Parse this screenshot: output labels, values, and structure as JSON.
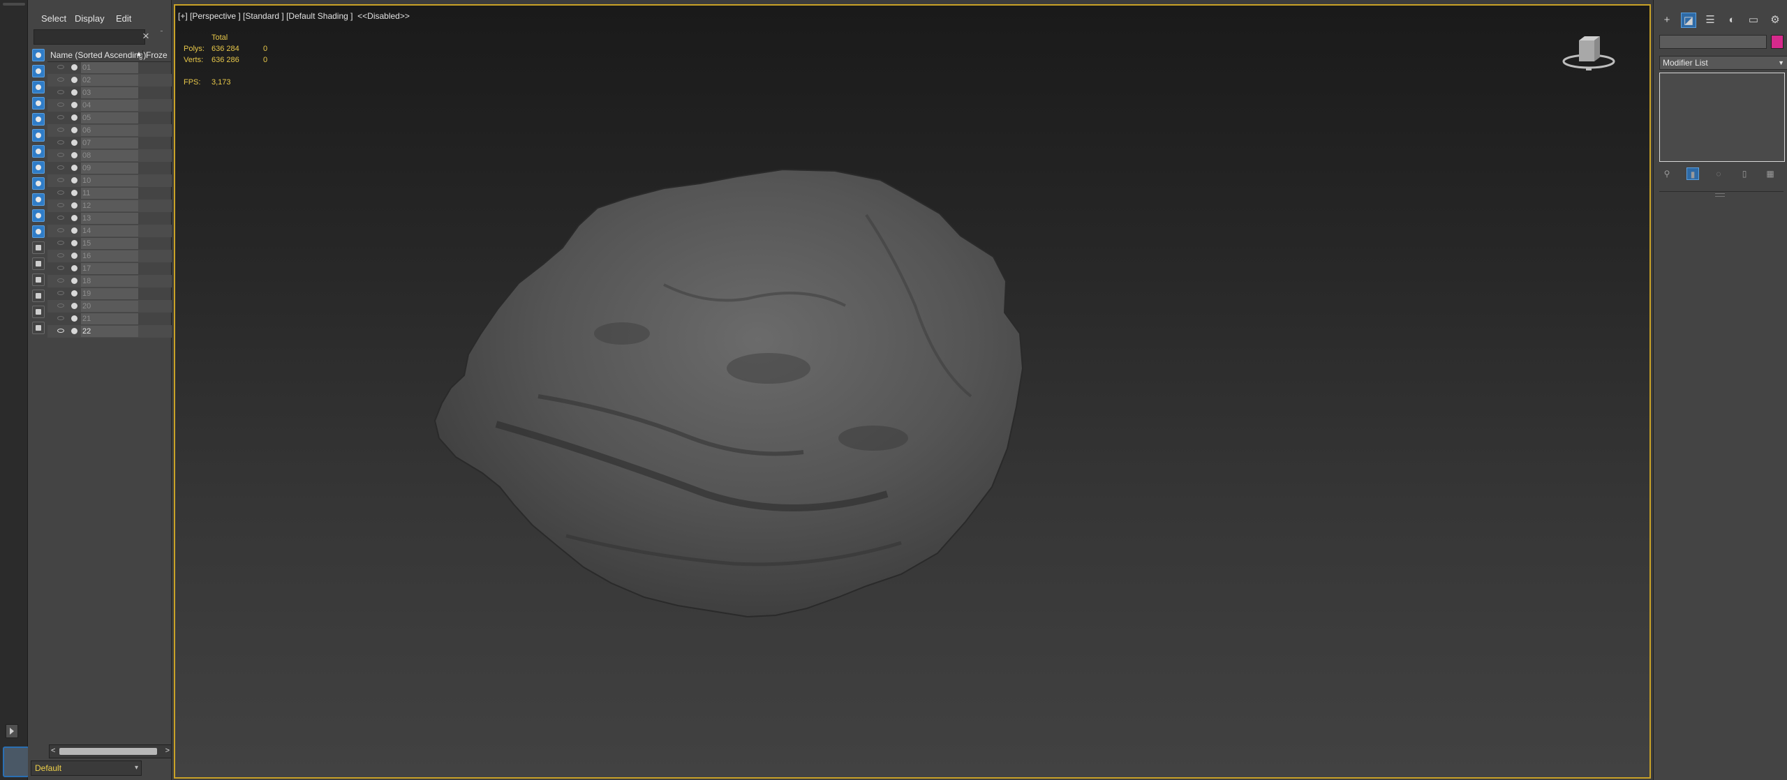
{
  "explorer": {
    "menu": {
      "select": "Select",
      "display": "Display",
      "edit": "Edit"
    },
    "search": {
      "value": "",
      "placeholder": ""
    },
    "clear_icon": "×",
    "filter_tools": [
      {
        "name": "geometry-filter-icon",
        "on": true
      },
      {
        "name": "shapes-filter-icon",
        "on": true
      },
      {
        "name": "lights-filter-icon",
        "on": true
      },
      {
        "name": "cameras-filter-icon",
        "on": true
      },
      {
        "name": "helpers-filter-icon",
        "on": true
      },
      {
        "name": "space-warps-filter-icon",
        "on": true
      },
      {
        "name": "groups-filter-icon",
        "on": true
      },
      {
        "name": "xrefs-filter-icon",
        "on": true
      },
      {
        "name": "bones-filter-icon",
        "on": true
      },
      {
        "name": "containers-filter-icon",
        "on": true
      },
      {
        "name": "frozen-filter-icon",
        "on": true
      },
      {
        "name": "hidden-filter-icon",
        "on": true
      },
      {
        "name": "select-all-icon",
        "on": false
      },
      {
        "name": "select-none-icon",
        "on": false
      },
      {
        "name": "invert-selection-icon",
        "on": false
      },
      {
        "name": "display-children-icon",
        "on": false
      },
      {
        "name": "filter-icon",
        "on": false
      },
      {
        "name": "layers-icon",
        "on": false
      }
    ],
    "columns": {
      "name": "Name (Sorted Ascending)",
      "sort_arrow": "▲",
      "frozen": "Froze"
    },
    "objects": [
      "01",
      "02",
      "03",
      "04",
      "05",
      "06",
      "07",
      "08",
      "09",
      "10",
      "11",
      "12",
      "13",
      "14",
      "15",
      "16",
      "17",
      "18",
      "19",
      "20",
      "21",
      "22"
    ],
    "active_object": "22",
    "layer": "Default",
    "layer_arrow": "▾",
    "scroll_left": "<",
    "scroll_right": ">"
  },
  "viewport": {
    "label": "[+] [Perspective ] [Standard ] [Default Shading ]  <<Disabled>>",
    "stats": {
      "header": "Total",
      "polys_label": "Polys:",
      "polys_total": "636 284",
      "polys_sel": "0",
      "verts_label": "Verts:",
      "verts_total": "636 286",
      "verts_sel": "0",
      "fps_label": "FPS:",
      "fps": "3,173"
    }
  },
  "command_panel": {
    "tabs": [
      {
        "name": "create-tab-icon",
        "glyph": "+",
        "selected": false
      },
      {
        "name": "modify-tab-icon",
        "glyph": "◪",
        "selected": true
      },
      {
        "name": "hierarchy-tab-icon",
        "glyph": "☰",
        "selected": false
      },
      {
        "name": "motion-tab-icon",
        "glyph": "◐",
        "selected": false
      },
      {
        "name": "display-tab-icon",
        "glyph": "▭",
        "selected": false
      },
      {
        "name": "utilities-tab-icon",
        "glyph": "⚙",
        "selected": false
      }
    ],
    "object_name": "",
    "object_color": "#d62a8c",
    "modifier_list_label": "Modifier List",
    "stack_tools": [
      {
        "name": "pin-stack-icon",
        "glyph": "⚲",
        "selected": false
      },
      {
        "name": "show-end-result-icon",
        "glyph": "▮",
        "selected": true
      },
      {
        "name": "make-unique-icon",
        "glyph": "◌",
        "selected": false
      },
      {
        "name": "remove-modifier-icon",
        "glyph": "▯",
        "selected": false
      },
      {
        "name": "configure-modifier-sets-icon",
        "glyph": "▦",
        "selected": false
      }
    ]
  }
}
